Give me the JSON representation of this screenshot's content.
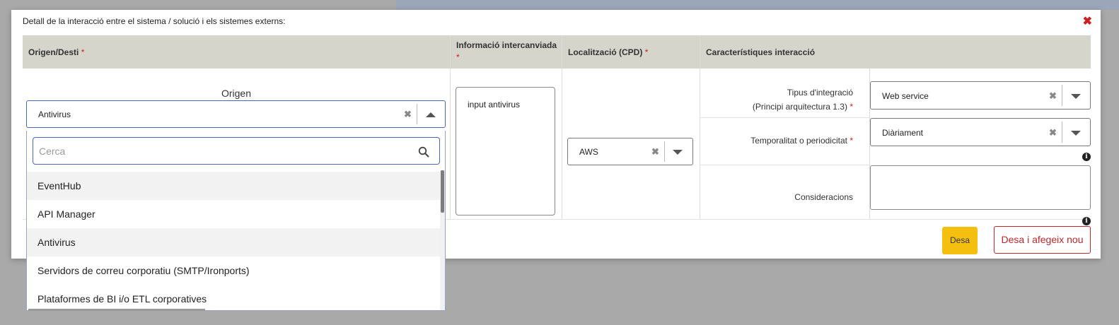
{
  "modal": {
    "title": "Detall de la interacció entre el sistema / solució i els sistemes externs:",
    "close_icon": "close-icon"
  },
  "headers": {
    "origen_desti": "Origen/Desti",
    "informacio": "Informació intercanviada",
    "localitzacio": "Localització (CPD)",
    "caracteristiques": "Característiques interacció",
    "required_mark": "*"
  },
  "origen": {
    "label": "Origen",
    "selected": "Antivirus",
    "search_placeholder": "Cerca",
    "options": [
      "EventHub",
      "API Manager",
      "Antivirus",
      "Servidors de correu corporatiu (SMTP/Ironports)",
      "Plataformes de BI i/o ETL corporatives"
    ]
  },
  "informacio": {
    "value": "input antivirus"
  },
  "localitzacio": {
    "selected": "AWS"
  },
  "caracteristiques": {
    "tipus_label_1": "Tipus d'integració",
    "tipus_label_2": "(Principi arquitectura 1.3)",
    "tipus_value": "Web service",
    "temporalitat_label": "Temporalitat o periodicitat",
    "temporalitat_value": "Diàriament",
    "consideracions_label": "Consideracions",
    "consideracions_value": ""
  },
  "buttons": {
    "desa": "Desa",
    "desa_nou": "Desa i afegeix nou"
  },
  "colors": {
    "header_bg": "#d5d5cb",
    "required": "#cc1f1f",
    "desa_bg": "#f5bf0f",
    "desa_nou_border": "#c0262b"
  }
}
